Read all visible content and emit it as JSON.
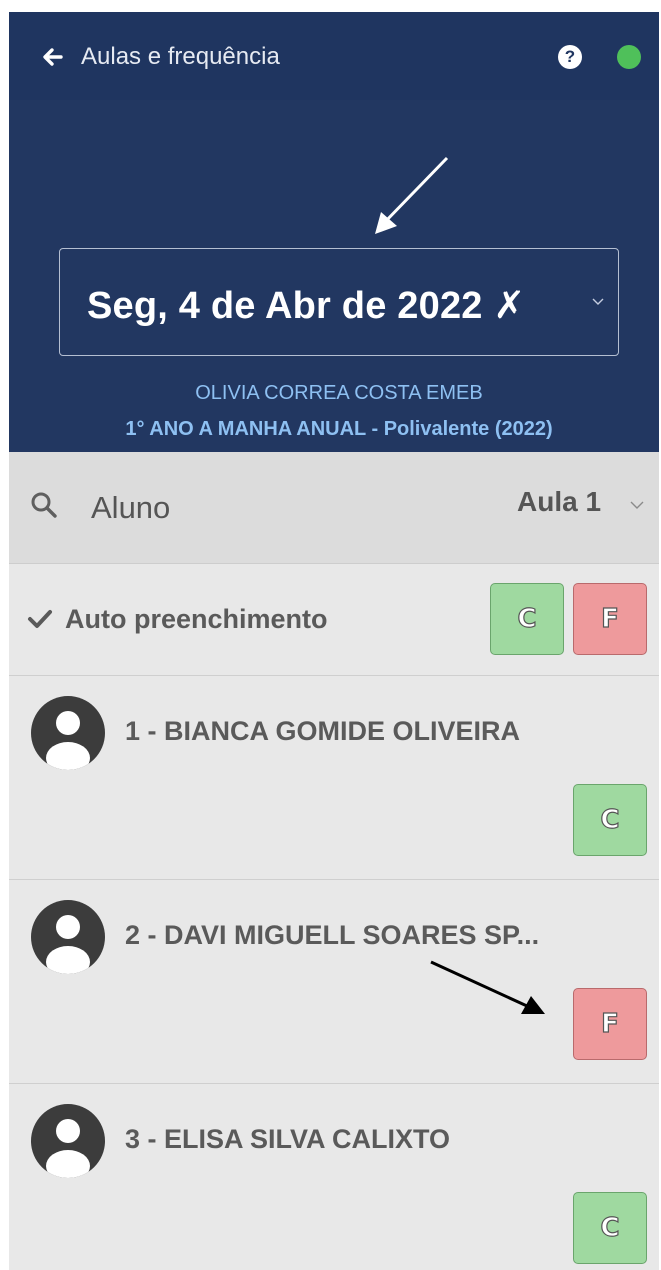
{
  "topbar": {
    "title": "Aulas e frequência",
    "help_icon": "?",
    "status_color": "#4fc05a"
  },
  "header": {
    "date": "Seg, 4 de Abr de 2022 ✗",
    "school": "OLIVIA CORREA COSTA EMEB",
    "class_name": "1° ANO A MANHA ANUAL - Polivalente (2022)"
  },
  "search": {
    "placeholder": "Aluno",
    "lesson_label": "Aula 1"
  },
  "autofill": {
    "label": "Auto preenchimento",
    "present_label": "C",
    "absent_label": "F"
  },
  "students": [
    {
      "name": "1 - BIANCA GOMIDE OLIVEIRA",
      "status": "C"
    },
    {
      "name": "2 - DAVI MIGUELL SOARES SP...",
      "status": "F"
    },
    {
      "name": "3 - ELISA SILVA CALIXTO",
      "status": "C"
    }
  ],
  "colors": {
    "topbar": "#1f3560",
    "header": "#223761",
    "accent_text": "#8ec0f2",
    "present": "#9fd9a0",
    "absent": "#ee9a9c"
  }
}
